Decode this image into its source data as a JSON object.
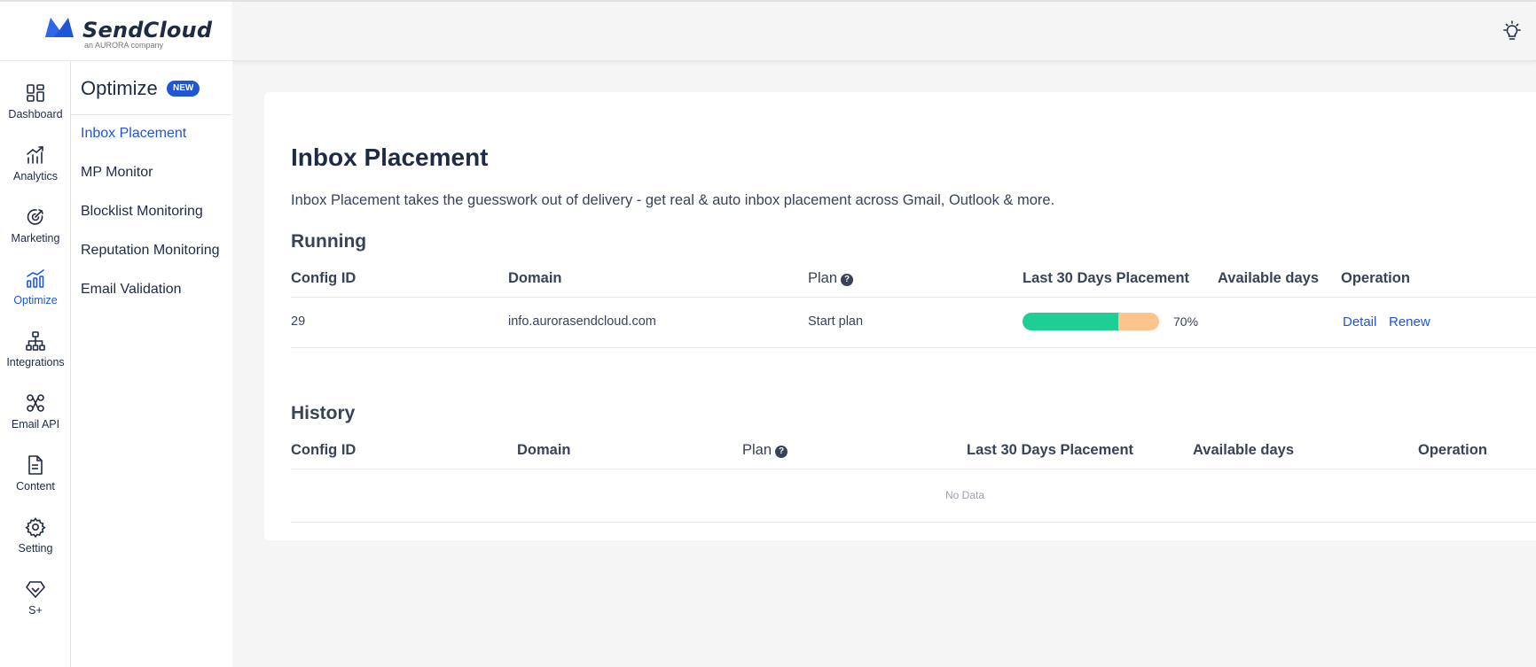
{
  "brand": {
    "name": "SendCloud",
    "tagline": "an AURORA company",
    "color": "#1f56d6"
  },
  "rail": {
    "items": [
      {
        "label": "Dashboard",
        "icon": "grid-icon"
      },
      {
        "label": "Analytics",
        "icon": "chart-trend-icon"
      },
      {
        "label": "Marketing",
        "icon": "target-icon"
      },
      {
        "label": "Optimize",
        "icon": "bar-chart-icon",
        "active": true
      },
      {
        "label": "Integrations",
        "icon": "hierarchy-icon"
      },
      {
        "label": "Email API",
        "icon": "api-icon"
      },
      {
        "label": "Content",
        "icon": "document-icon"
      },
      {
        "label": "Setting",
        "icon": "gear-icon"
      },
      {
        "label": "S+",
        "icon": "diamond-icon"
      }
    ]
  },
  "submenu": {
    "title": "Optimize",
    "badge": "NEW",
    "items": [
      {
        "label": "Inbox Placement",
        "active": true
      },
      {
        "label": "MP Monitor"
      },
      {
        "label": "Blocklist Monitoring"
      },
      {
        "label": "Reputation Monitoring"
      },
      {
        "label": "Email Validation"
      }
    ]
  },
  "main": {
    "title": "Inbox Placement",
    "description": "Inbox Placement takes the guesswork out of delivery - get real & auto inbox placement across Gmail, Outlook & more.",
    "running": {
      "title": "Running",
      "columns": {
        "config_id": "Config ID",
        "domain": "Domain",
        "plan": "Plan",
        "placement": "Last 30 Days Placement",
        "available_days": "Available days",
        "operation": "Operation"
      },
      "rows": [
        {
          "config_id": "29",
          "domain": "info.aurorasendcloud.com",
          "plan": "Start plan",
          "placement_fraction": 0.7,
          "placement_label": "70%",
          "available_days": "",
          "actions": {
            "detail": "Detail",
            "renew": "Renew"
          }
        }
      ]
    },
    "history": {
      "title": "History",
      "columns": {
        "config_id": "Config ID",
        "domain": "Domain",
        "plan": "Plan",
        "placement": "Last 30 Days Placement",
        "available_days": "Available days",
        "operation": "Operation"
      },
      "empty_text": "No Data"
    }
  },
  "colors": {
    "primary": "#1f56d6",
    "progress_good": "#1ecf95",
    "progress_rest": "#ffc38e"
  }
}
